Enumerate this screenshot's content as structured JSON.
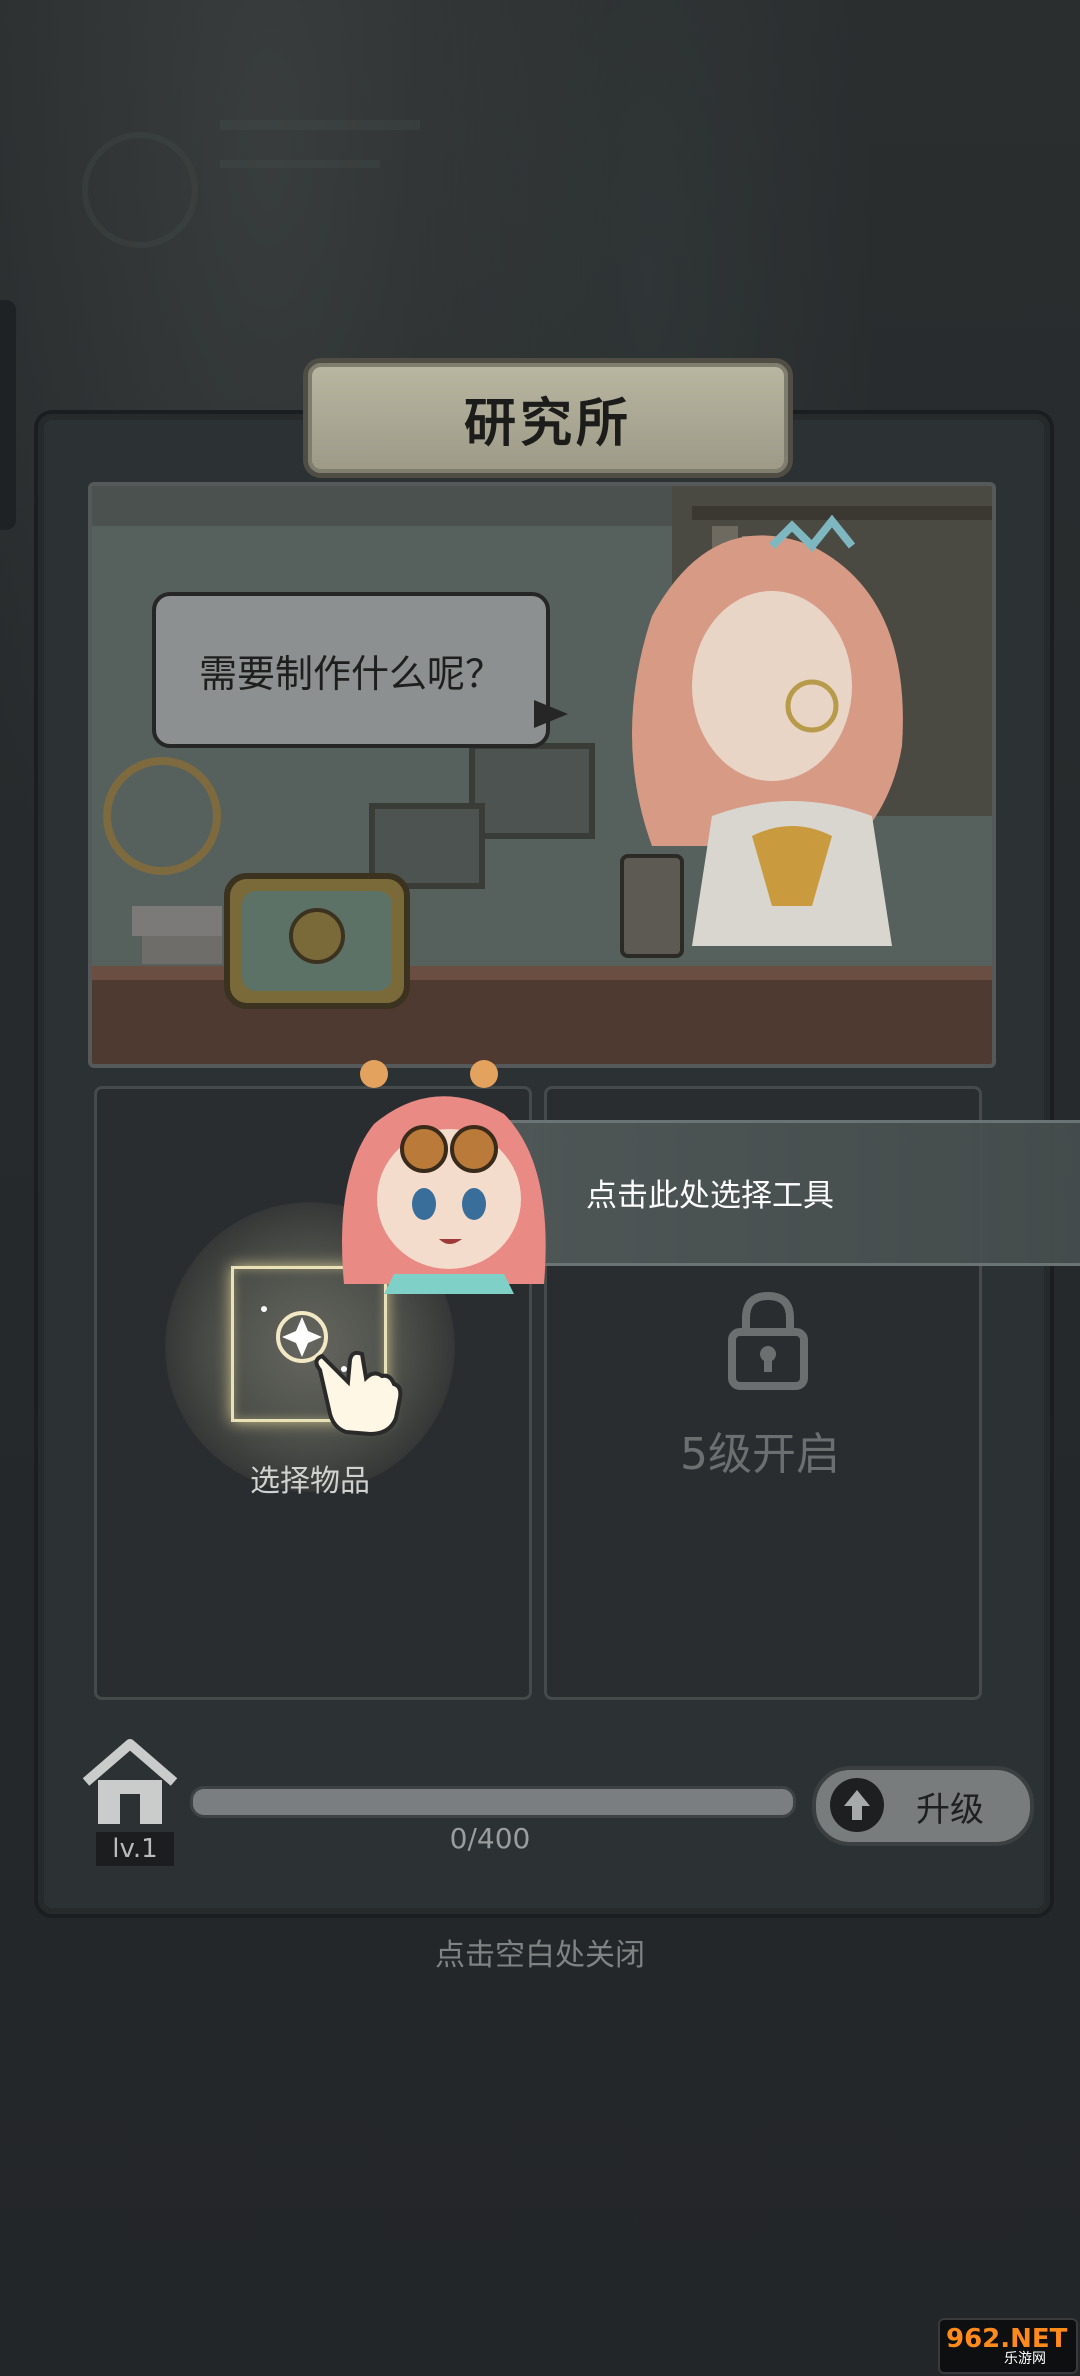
{
  "dialog": {
    "title": "研究所",
    "speech": "需要制作什么呢？"
  },
  "slots": {
    "left_label": "选择物品",
    "right_unlock": "5级开启"
  },
  "guide": {
    "text": "点击此处选择工具"
  },
  "progress": {
    "level": "lv.1",
    "xp_text": "0/400",
    "xp_fraction": 0,
    "upgrade_label": "升级"
  },
  "close_hint": "点击空白处关闭",
  "watermark": {
    "logo": "962.NET",
    "sub": "乐游网"
  },
  "colors": {
    "panel": "#2c3133",
    "plaque": "#b9b7a2",
    "accent_glow": "#e9e2b8",
    "xp_fill": "#d8a23a"
  },
  "icons": [
    "house-icon",
    "lock-icon",
    "arrow-up-icon",
    "sparkle-icon",
    "pointing-hand-icon"
  ]
}
